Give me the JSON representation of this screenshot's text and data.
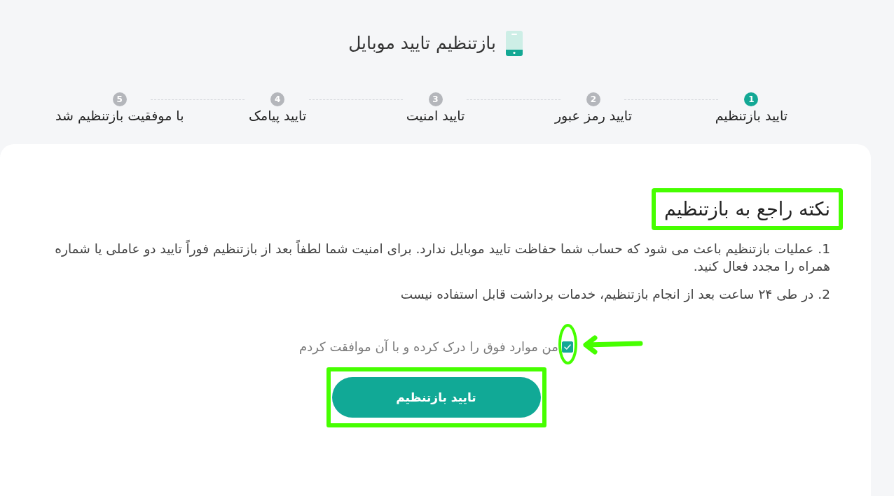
{
  "page": {
    "title": "بازتنظیم تایید موبایل"
  },
  "steps": [
    {
      "number": "1",
      "label": "تایید بازتنظیم",
      "selected": true
    },
    {
      "number": "2",
      "label": "تایید رمز عبور",
      "selected": false
    },
    {
      "number": "3",
      "label": "تایید امنیت",
      "selected": false
    },
    {
      "number": "4",
      "label": "تایید پیامک",
      "selected": false
    },
    {
      "number": "5",
      "label": "با موفقیت بازتنظیم شد",
      "selected": false
    }
  ],
  "notice": {
    "heading": "نکته راجع به بازتنظیم",
    "highlighted": true,
    "items": [
      {
        "number": "1.",
        "text": "عملیات بازتنظیم باعث می شود که حساب شما حفاظت تایید موبایل ندارد. برای امنیت شما لطفاً بعد از بازتنظیم فوراً تایید دو عاملی یا شماره همراه را مجدد فعال کنید."
      },
      {
        "number": "2.",
        "text": "در طی ۲۴ ساعت بعد از انجام بازتنظیم، خدمات برداشت قابل استفاده نیست"
      }
    ]
  },
  "agreement": {
    "label": "من موارد فوق را درک کرده و با آن موافقت کردم",
    "checked": true,
    "highlighted": true,
    "pointer_arrow": true
  },
  "confirm_button": {
    "label": "تایید بازتنظیم",
    "highlighted": true
  }
}
